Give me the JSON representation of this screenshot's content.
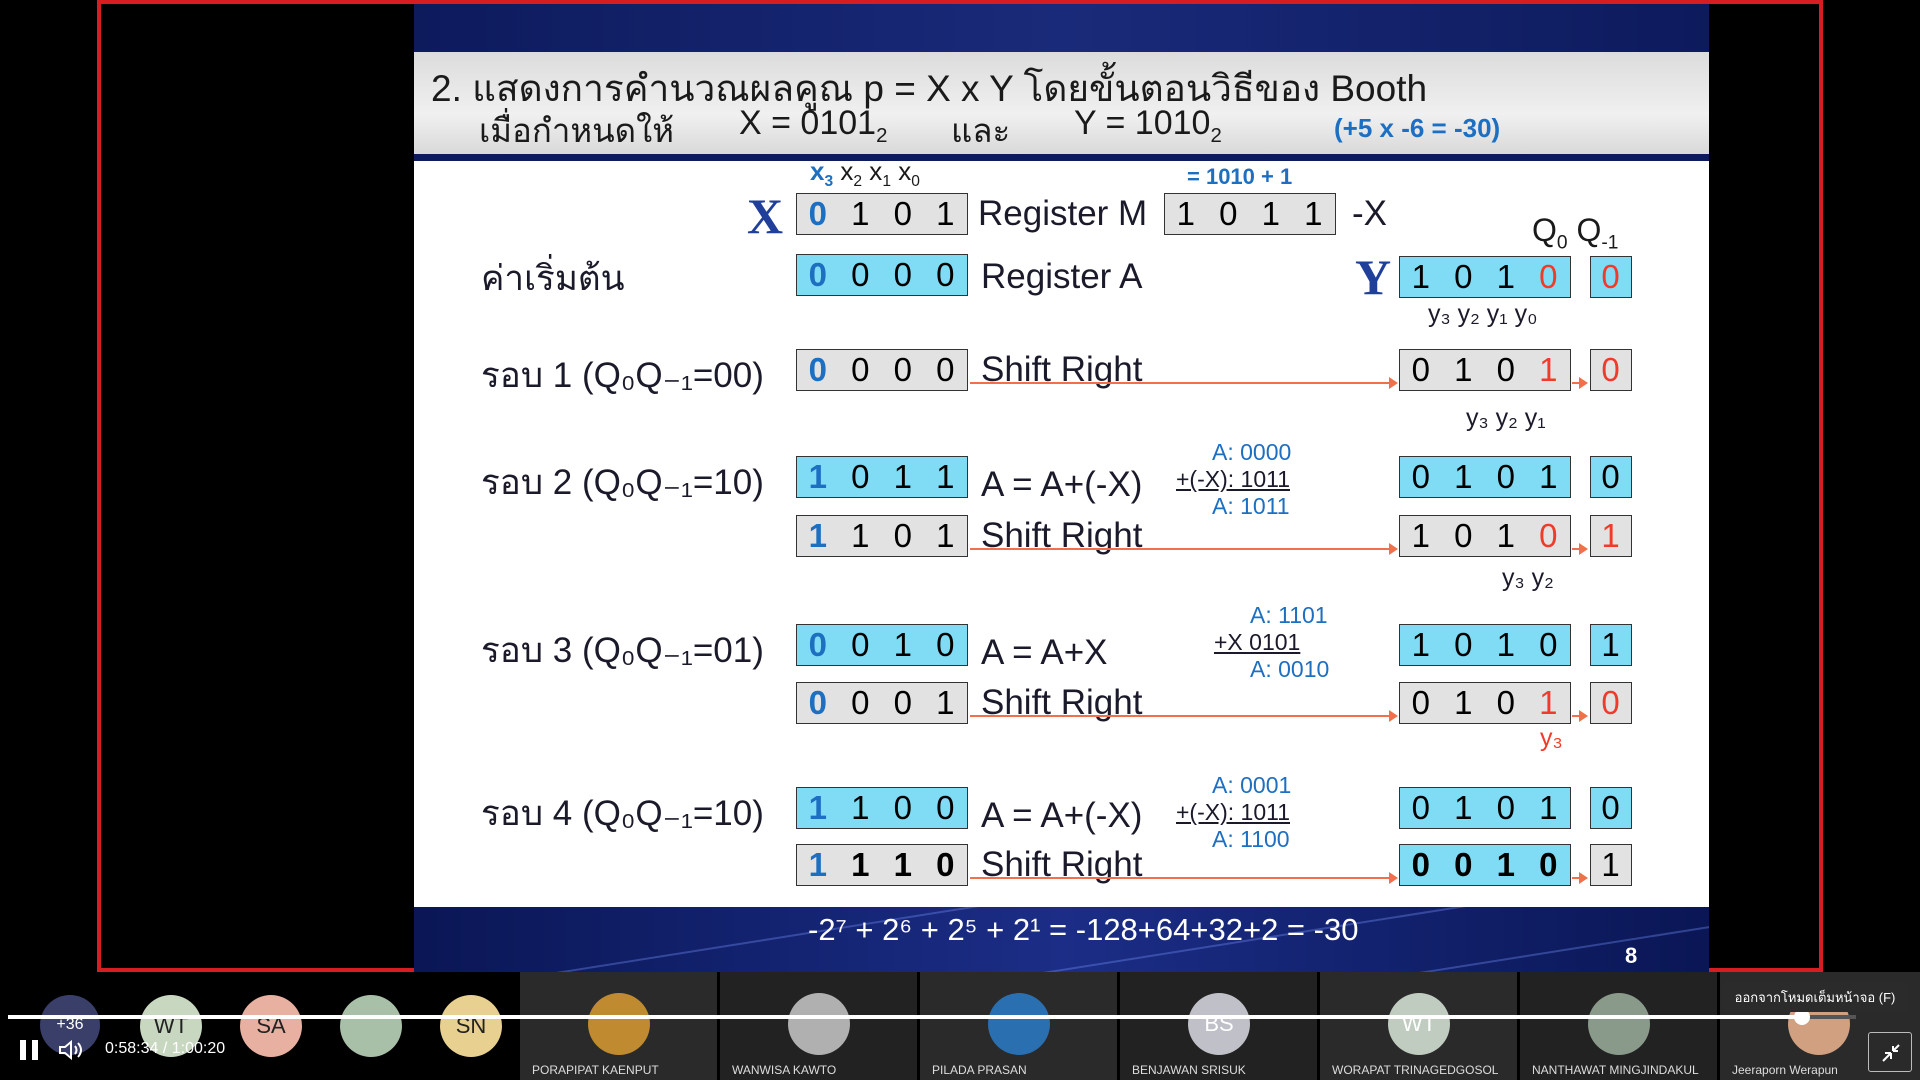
{
  "slide": {
    "title_line1": "2. แสดงการคำนวณผลคูณ p = X x Y โดยขั้นตอนวิธีของ Booth",
    "title_line2_prefix": "เมื่อกำหนดให้",
    "title_x": "X = 0101",
    "title_and": "และ",
    "title_y": "Y = 1010",
    "title_sub": "2",
    "title_note": "(+5 x -6  = -30)",
    "neg_x_note": "= 1010 + 1",
    "x_symbol": "X",
    "y_symbol": "Y",
    "register_m_label": "Register M",
    "register_a_label": "Register A",
    "neg_x_label": "-X",
    "init_label": "ค่าเริ่มต้น",
    "q_header": "Q",
    "q0_sub": "0",
    "qm1_sub": "-1",
    "bits_header": "x",
    "register_m": [
      "0",
      "1",
      "0",
      "1"
    ],
    "neg_x": [
      "1",
      "0",
      "1",
      "1"
    ],
    "register_a_init": [
      "0",
      "0",
      "0",
      "0"
    ],
    "y_init": [
      "1",
      "0",
      "1",
      "0"
    ],
    "q_init": "0",
    "y_init_anno": "y₃ y₂ y₁ y₀",
    "rounds": [
      {
        "label": "รอบ 1 (Q₀Q₋₁=00)",
        "op1_label": "Shift Right",
        "a1": [
          "0",
          "0",
          "0",
          "0"
        ],
        "q1": [
          "0",
          "1",
          "0",
          "1"
        ],
        "qm1": "0",
        "anno": "y₃ y₂ y₁"
      },
      {
        "label": "รอบ 2 (Q₀Q₋₁=10)",
        "op1_label": "A = A+(-X)",
        "a1": [
          "1",
          "0",
          "1",
          "1"
        ],
        "q1": [
          "0",
          "1",
          "0",
          "1"
        ],
        "qm1": "0",
        "op2_label": "Shift Right",
        "a2": [
          "1",
          "1",
          "0",
          "1"
        ],
        "q2": [
          "1",
          "0",
          "1",
          "0"
        ],
        "qm2": "1",
        "calc": [
          "A: 0000",
          "+(-X): 1011",
          "A: 1011"
        ],
        "anno": "y₃ y₂"
      },
      {
        "label": "รอบ 3 (Q₀Q₋₁=01)",
        "op1_label": "A = A+X",
        "a1": [
          "0",
          "0",
          "1",
          "0"
        ],
        "q1": [
          "1",
          "0",
          "1",
          "0"
        ],
        "qm1": "1",
        "op2_label": "Shift Right",
        "a2": [
          "0",
          "0",
          "0",
          "1"
        ],
        "q2": [
          "0",
          "1",
          "0",
          "1"
        ],
        "qm2": "0",
        "calc": [
          "A: 1101",
          "+X  0101",
          "A: 0010"
        ],
        "anno": "y₃"
      },
      {
        "label": "รอบ 4 (Q₀Q₋₁=10)",
        "op1_label": "A = A+(-X)",
        "a1": [
          "1",
          "1",
          "0",
          "0"
        ],
        "q1": [
          "0",
          "1",
          "0",
          "1"
        ],
        "qm1": "0",
        "op2_label": "Shift Right",
        "a2": [
          "1",
          "1",
          "1",
          "0"
        ],
        "q2": [
          "0",
          "0",
          "1",
          "0"
        ],
        "qm2": "1",
        "calc": [
          "A: 0001",
          "+(-X): 1011",
          "A: 1100"
        ]
      }
    ],
    "result": "-2⁷ + 2⁶ + 2⁵ + 2¹ = -128+64+32+2 = -30",
    "page_number": "8"
  },
  "player": {
    "current_time": "0:58:34",
    "total_time": "1:00:20",
    "separator": "/",
    "progress": 0.971,
    "exit_fullscreen_tooltip": "ออกจากโหมดเต็มหน้าจอ (F)"
  },
  "participants": {
    "more_count": "+36",
    "avatars": [
      {
        "initials": "WT",
        "color": "#c8d8c0"
      },
      {
        "initials": "SA",
        "color": "#e8b0a0"
      },
      {
        "initials": "",
        "color": "#a8c0a8"
      },
      {
        "initials": "SN",
        "color": "#e8d090"
      }
    ],
    "tiles": [
      {
        "name": "PORAPIPAT KAENPUT"
      },
      {
        "name": "WANWISA KAWTO"
      },
      {
        "name": "PILADA PRASAN"
      },
      {
        "name": "BENJAWAN SRISUK",
        "initials": "BS"
      },
      {
        "name": "WORAPAT TRINAGEDGOSOL",
        "initials": "WT"
      },
      {
        "name": "NANTHAWAT MINGJINDAKUL"
      },
      {
        "name": "Jeeraporn Werapun"
      }
    ]
  }
}
